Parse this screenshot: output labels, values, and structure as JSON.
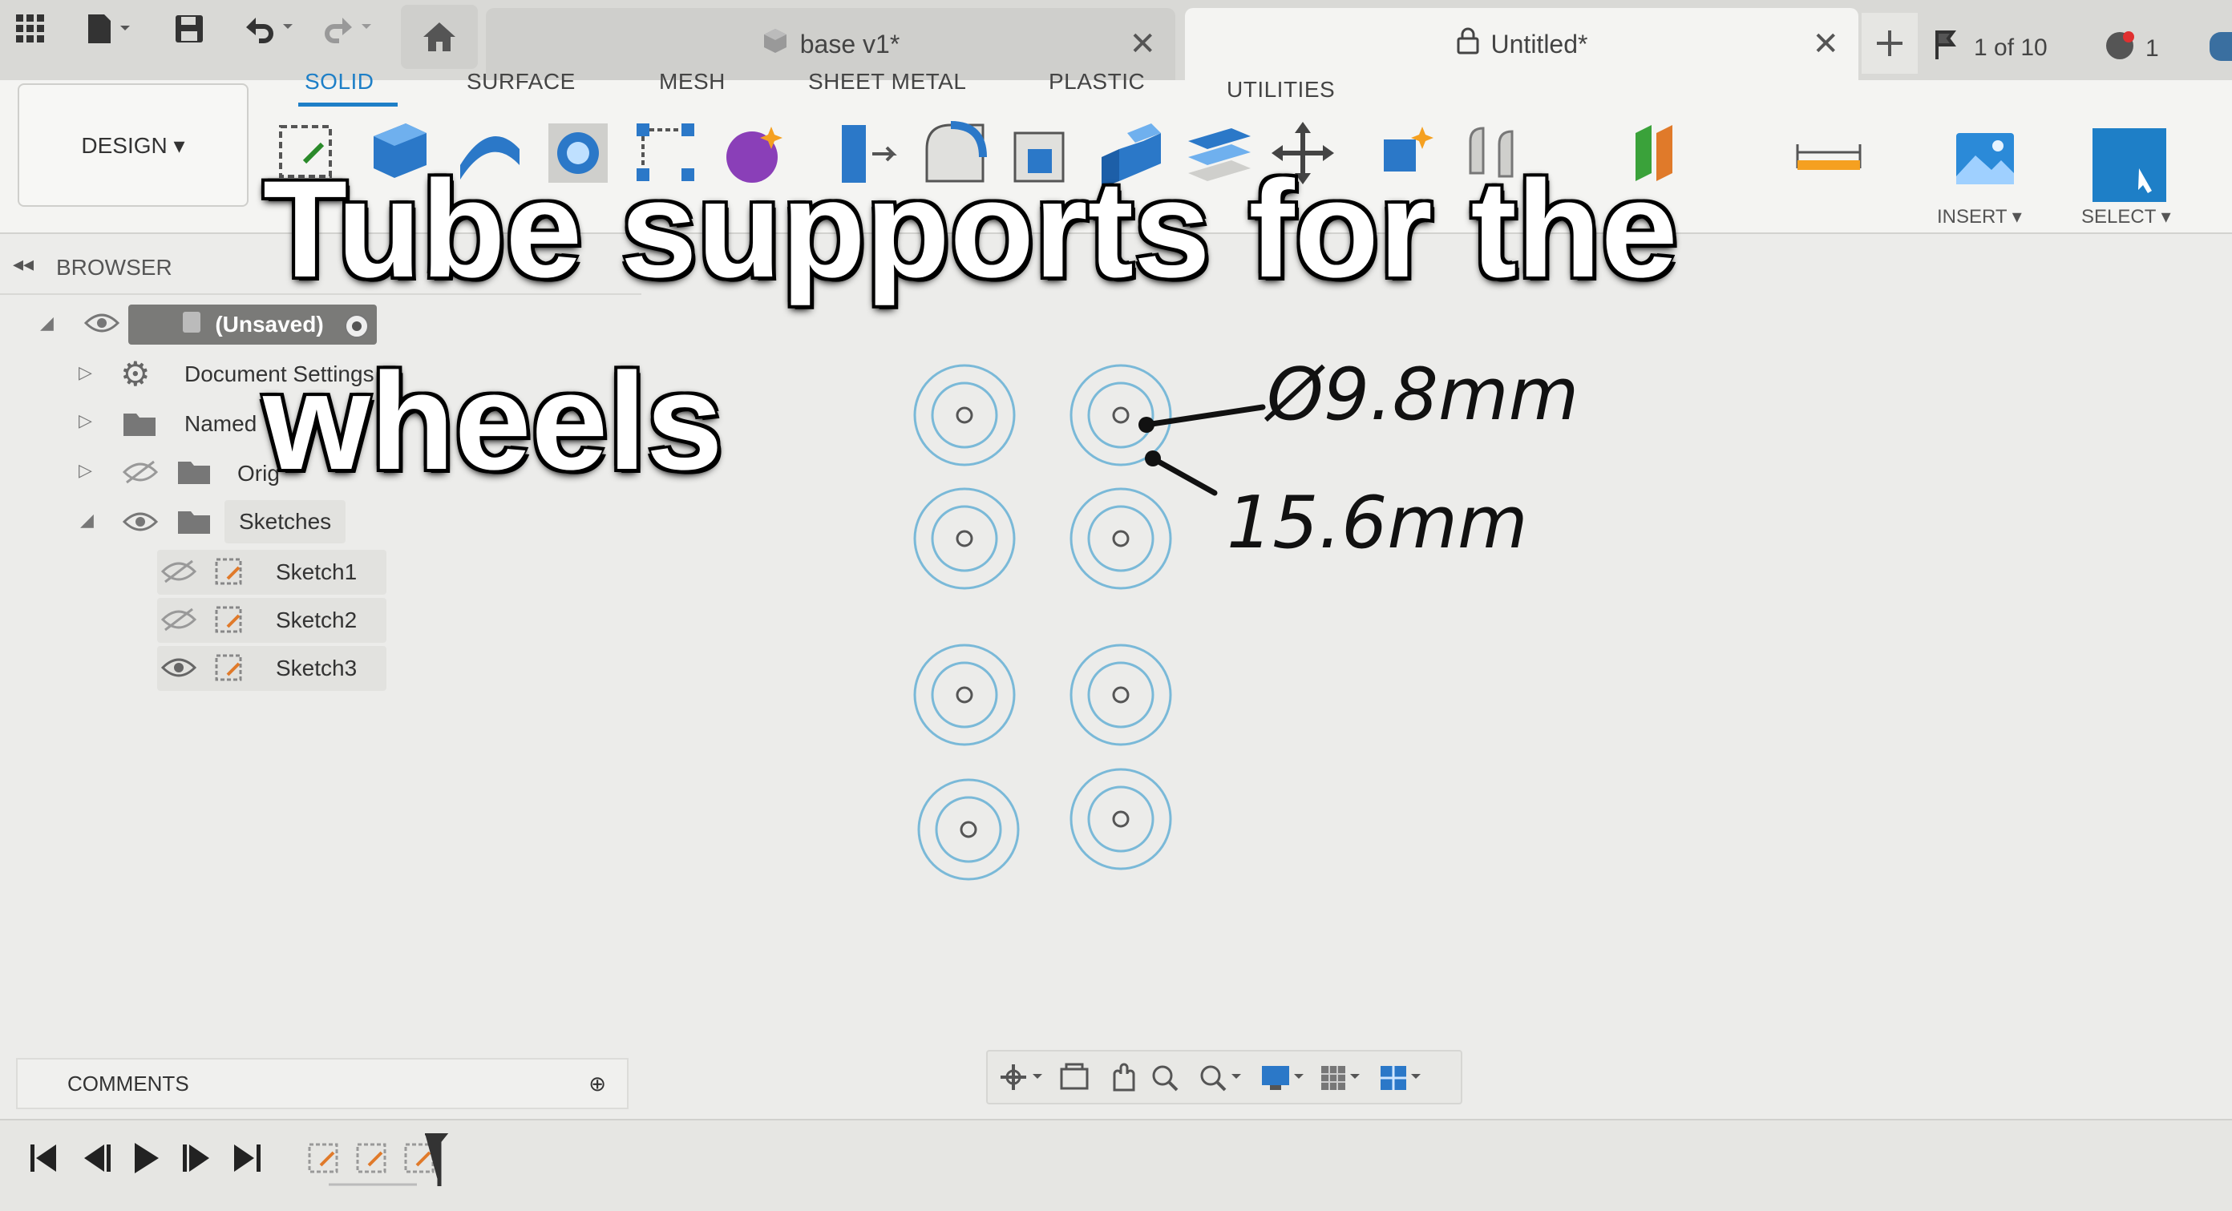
{
  "quick_access": {
    "grid_icon": "grid-icon",
    "file_icon": "file-icon",
    "save_icon": "save-icon",
    "undo_icon": "undo-icon",
    "redo_icon": "redo-icon",
    "home_icon": "home-icon"
  },
  "tabs": [
    {
      "label": "base v1*",
      "icon": "component-icon"
    },
    {
      "label": "Untitled*",
      "icon": "lock-icon"
    }
  ],
  "tab_controls": {
    "add_icon": "plus-icon",
    "job_status": "1 of 10",
    "notifications": "1"
  },
  "ribbon": {
    "workspace": "DESIGN ▾",
    "tabs": [
      "SOLID",
      "SURFACE",
      "MESH",
      "SHEET METAL",
      "PLASTIC",
      "UTILITIES"
    ],
    "active_tab": "SOLID",
    "insert_label": "INSERT ▾",
    "select_label": "SELECT ▾"
  },
  "browser": {
    "title": "BROWSER",
    "root": "(Unsaved)",
    "items": [
      "Document Settings",
      "Named",
      "Orig",
      "Sketches"
    ],
    "sketches": [
      "Sketch1",
      "Sketch2",
      "Sketch3"
    ]
  },
  "comments": {
    "label": "COMMENTS"
  },
  "overlay": {
    "title_line1": "Tube supports for the",
    "title_line2": "wheels",
    "annotation_diameter": "Ø9.8mm",
    "annotation_outer": "15.6mm"
  },
  "colors": {
    "accent": "#1e7fc7",
    "sketch_circle": "#7ab9d8",
    "background": "#ececea"
  }
}
